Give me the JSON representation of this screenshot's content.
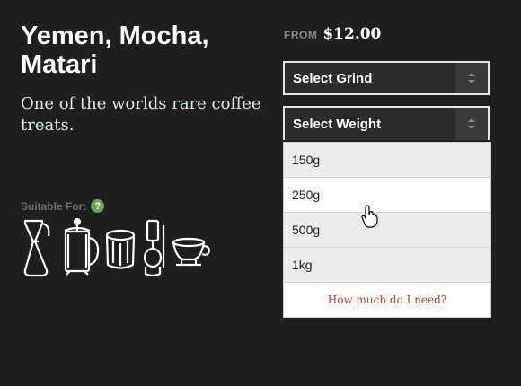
{
  "product": {
    "title_lines": [
      "Yemen, Mocha,",
      "Matari"
    ],
    "tagline": "One of the worlds rare coffee treats."
  },
  "suitable": {
    "label": "Suitable For:",
    "help_glyph": "?",
    "brewers": [
      "chemex-icon",
      "french-press-icon",
      "aeropress-icon",
      "siphon-icon",
      "pour-over-dripper-icon"
    ]
  },
  "price": {
    "from_label": "FROM",
    "value": "$12.00"
  },
  "grind_select": {
    "label": "Select Grind"
  },
  "weight_select": {
    "label": "Select Weight",
    "options": [
      "150g",
      "250g",
      "500g",
      "1kg"
    ],
    "hovered_option": "250g",
    "help_link": "How much do I need?"
  },
  "colors": {
    "background": "#1f1f1f",
    "help_badge": "#6aa84f",
    "link": "#b5412a"
  }
}
